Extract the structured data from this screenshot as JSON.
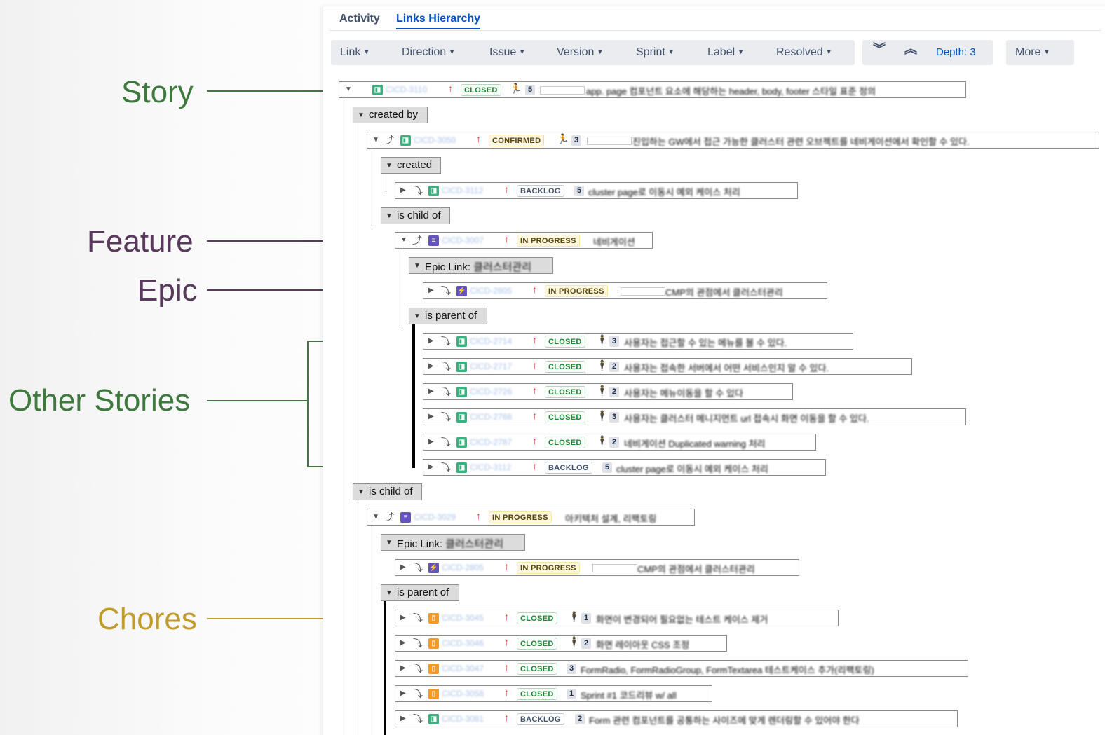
{
  "tabs": [
    "Activity",
    "Links Hierarchy"
  ],
  "toolbar": {
    "filters": [
      "Link",
      "Direction",
      "Issue",
      "Version",
      "Sprint",
      "Label",
      "Resolved"
    ],
    "expand_all_icon": "double-chevron-down-icon",
    "collapse_all_icon": "double-chevron-up-icon",
    "depth": "Depth: 3",
    "more": "More"
  },
  "annotations": [
    {
      "label": "Story",
      "color": "#3e7a3e"
    },
    {
      "label": "Feature",
      "color": "#5a3a5c"
    },
    {
      "label": "Epic",
      "color": "#5a3a5c"
    },
    {
      "label": "Other Stories",
      "color": "#3e7a3e"
    },
    {
      "label": "Chores",
      "color": "#c09a2a"
    }
  ],
  "colors": {
    "accent": "#0052cc",
    "story": "#36b37e",
    "feature": "#6554c0",
    "chore": "#ff991f",
    "priority": "#d04437"
  },
  "groups": [
    {
      "label": "created by"
    },
    {
      "label": "created"
    },
    {
      "label": "is child of"
    },
    {
      "label": "Epic Link: ",
      "blurred": "클러스터관리"
    },
    {
      "label": "is parent of"
    },
    {
      "label": "is child of"
    },
    {
      "label": "Epic Link: ",
      "blurred": "클러스터관리"
    },
    {
      "label": "is parent of"
    }
  ],
  "issues": [
    {
      "key": "CICD-3110",
      "status": "CLOSED",
      "pts": "5",
      "summary": "app. page 컴포넌트 요소에 해당하는 header, body, footer 스타일 표준 정의"
    },
    {
      "key": "CICD-3050",
      "status": "CONFIRMED",
      "pts": "3",
      "summary": "진입하는 GW에서 접근 가능한 클러스터 관련 오브젝트를 네비게이션에서 확인할 수 있다."
    },
    {
      "key": "CICD-3112",
      "status": "BACKLOG",
      "pts": "5",
      "summary": "cluster page로 이동시 예외 케이스 처리"
    },
    {
      "key": "CICD-3007",
      "status": "IN PROGRESS",
      "pts": "",
      "summary": "네비게이션"
    },
    {
      "key": "CICD-2805",
      "status": "IN PROGRESS",
      "pts": "",
      "summary": "CMP의 관점에서 클러스터관리"
    },
    {
      "key": "CICD-2714",
      "status": "CLOSED",
      "pts": "3",
      "summary": "사용자는 접근할 수 있는 메뉴를 볼 수 있다."
    },
    {
      "key": "CICD-2717",
      "status": "CLOSED",
      "pts": "2",
      "summary": "사용자는 접속한 서버에서 어떤 서비스인지 알 수 있다."
    },
    {
      "key": "CICD-2726",
      "status": "CLOSED",
      "pts": "2",
      "summary": "사용자는 메뉴이동을 할 수 있다"
    },
    {
      "key": "CICD-2768",
      "status": "CLOSED",
      "pts": "3",
      "summary": "사용자는 클러스터 메니지먼트 url 접속시 화면 이동을 할 수 있다."
    },
    {
      "key": "CICD-2787",
      "status": "CLOSED",
      "pts": "2",
      "summary": "네비게이션 Duplicated warning 처리"
    },
    {
      "key": "CICD-3112",
      "status": "BACKLOG",
      "pts": "5",
      "summary": "cluster page로 이동시 예외 케이스 처리"
    },
    {
      "key": "CICD-3029",
      "status": "IN PROGRESS",
      "pts": "",
      "summary": "아키텍처 설계, 리팩토링"
    },
    {
      "key": "CICD-2805",
      "status": "IN PROGRESS",
      "pts": "",
      "summary": "CMP의 관점에서 클러스터관리"
    },
    {
      "key": "CICD-3045",
      "status": "CLOSED",
      "pts": "1",
      "summary": "화면이 변경되어 필요없는 테스트 케이스 제거"
    },
    {
      "key": "CICD-3046",
      "status": "CLOSED",
      "pts": "2",
      "summary": "화면 레이아웃 CSS 조정"
    },
    {
      "key": "CICD-3047",
      "status": "CLOSED",
      "pts": "3",
      "summary": "FormRadio, FormRadioGroup, FormTextarea 테스트케이스 추가(리팩토링)"
    },
    {
      "key": "CICD-3058",
      "status": "CLOSED",
      "pts": "1",
      "summary": "Sprint #1 코드리뷰 w/ all"
    },
    {
      "key": "CICD-3081",
      "status": "BACKLOG",
      "pts": "2",
      "summary": "Form 관련 컴포넌트를 공통하는 사이즈에 맞게 렌더링할 수 있어야 한다"
    }
  ]
}
